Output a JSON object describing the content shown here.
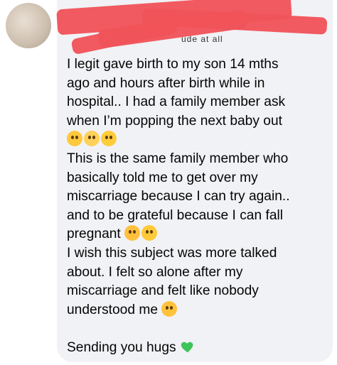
{
  "message": {
    "lines": [
      "I legit gave birth to my son 14 mths",
      "ago and hours after birth while in",
      "hospital.. I had a family member ask",
      "when I’m popping the next baby out",
      "This is the same family member who",
      "basically told me to get over my",
      "miscarriage because I can try again..",
      "and to be grateful because I can fall",
      "pregnant",
      "I wish this subject was more talked",
      "about. I felt so alone after my",
      "miscarriage and felt like nobody",
      "understood me",
      "Sending you hugs"
    ],
    "redacted_fragment": "ude at all"
  },
  "icons": {
    "emoji_row_1": [
      "face-with-tears-of-joy-icon",
      "weary-face-icon",
      "rolling-eyes-icon"
    ],
    "emoji_pregnant": [
      "flushed-face-icon",
      "thinking-face-icon"
    ],
    "emoji_understood": [
      "loudly-crying-face-icon"
    ],
    "emoji_hugs": [
      "green-heart-icon"
    ]
  },
  "colors": {
    "bubble": "#f0f2f5",
    "redaction": "#f0535a",
    "text": "#050505",
    "heart": "#3ec45a"
  }
}
